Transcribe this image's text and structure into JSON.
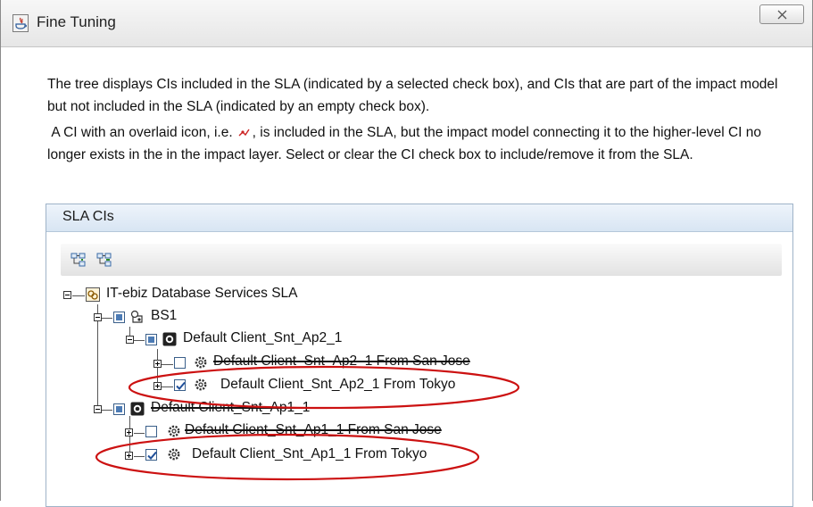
{
  "window": {
    "title": "Fine Tuning",
    "close_glyph": "x"
  },
  "description": {
    "paragraph1": "The tree displays CIs included in the SLA (indicated by a selected check box), and CIs that are part of the impact model but not included in the SLA (indicated by an empty check box).",
    "paragraph2_before_icon": "A CI with an overlaid icon, i.e.",
    "paragraph2_after_icon": ", is included in the SLA, but the impact model connecting it to the higher-level CI no longer exists in the in the impact layer. Select or clear the CI check box to include/remove it from the SLA."
  },
  "panel": {
    "title": "SLA CIs",
    "toolbar": {
      "expand_all_icon": "expand-all-icon",
      "collapse_all_icon": "collapse-all-icon"
    }
  },
  "tree": {
    "root": {
      "label": "IT-ebiz Database Services SLA",
      "icon": "sla-icon"
    },
    "bs1": {
      "label": "BS1",
      "icon": "business-service-icon",
      "checkbox": "partial"
    },
    "ap2": {
      "label": "Default Client_Snt_Ap2_1",
      "icon": "monitor-icon",
      "checkbox": "partial"
    },
    "ap2_sj": {
      "label": "Default Client_Snt_Ap2_1 From San Jose",
      "icon": "gear-icon",
      "checkbox": "unchecked",
      "struck": true
    },
    "ap2_tk": {
      "label": "Default Client_Snt_Ap2_1 From Tokyo",
      "icon": "gear-icon",
      "checkbox": "checked",
      "highlighted": true
    },
    "ap1": {
      "label": "Default Client_Snt_Ap1_1",
      "icon": "monitor-icon",
      "checkbox": "partial",
      "struck": true
    },
    "ap1_sj": {
      "label": "Default Client_Snt_Ap1_1 From San Jose",
      "icon": "gear-icon",
      "checkbox": "unchecked",
      "struck": true
    },
    "ap1_tk": {
      "label": "Default Client_Snt_Ap1_1 From Tokyo",
      "icon": "gear-icon",
      "checkbox": "checked",
      "highlighted": true
    }
  },
  "colors": {
    "annotation_ellipse": "#cc1111",
    "check_mark": "#1f4f9a",
    "panel_header": "#d8e5f3",
    "overlay_icon": "#cc2222"
  }
}
